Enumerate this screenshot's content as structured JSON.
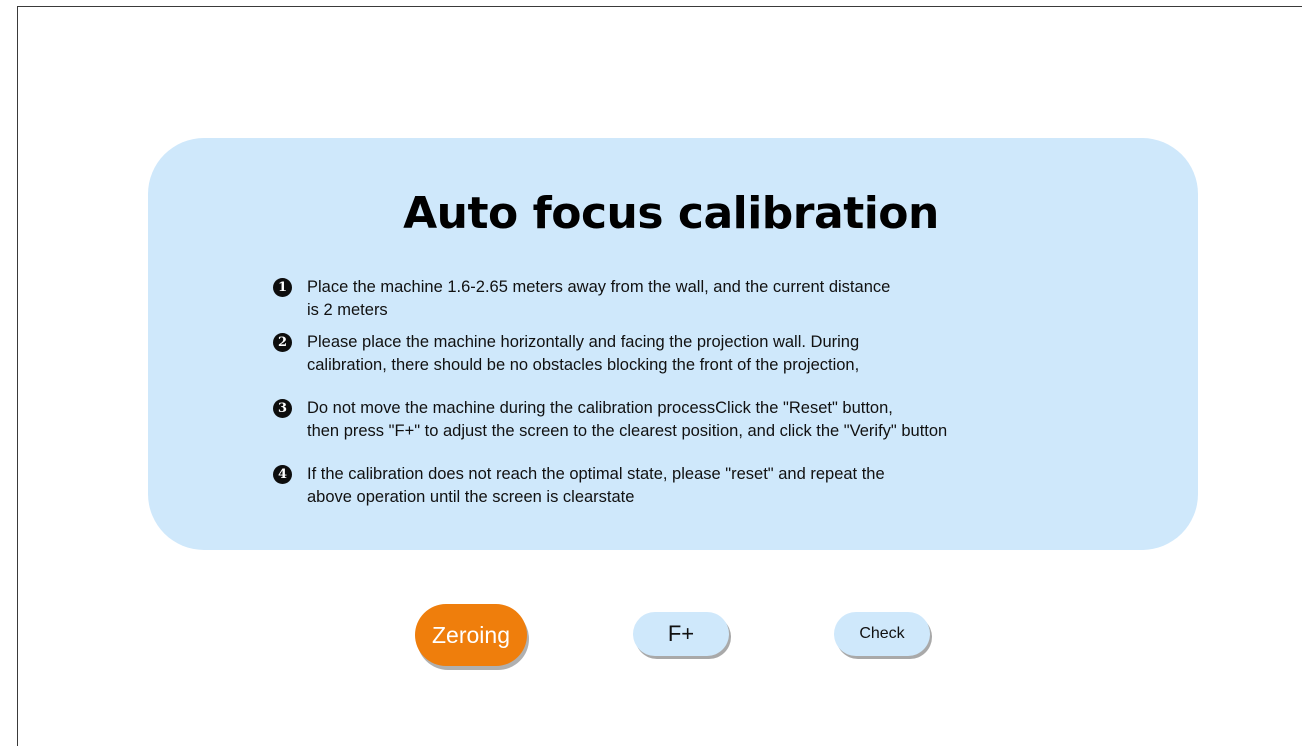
{
  "dialog": {
    "title": "Auto focus calibration",
    "steps": [
      {
        "number": "1",
        "lines": [
          "Place the machine 1.6-2.65 meters away from the wall, and the current distance",
          "is 2 meters"
        ]
      },
      {
        "number": "2",
        "lines": [
          "Please place the machine horizontally and facing the projection wall. During",
          "calibration, there should be no obstacles blocking the front of the projection,"
        ]
      },
      {
        "number": "3",
        "lines": [
          "Do not move the machine during the calibration processClick the \"Reset\" button,",
          "then press \"F+\" to adjust the screen to the clearest position, and click the \"Verify\" button"
        ]
      },
      {
        "number": "4",
        "lines": [
          "If the calibration does not reach the optimal state, please \"reset\" and repeat the",
          "above operation until the screen is clearstate"
        ]
      }
    ]
  },
  "buttons": {
    "zeroing": "Zeroing",
    "focus_plus": "F+",
    "check": "Check"
  },
  "colors": {
    "panel_background": "#cfe8fb",
    "primary_button": "#ef7e0c",
    "secondary_button": "#cfe8fb"
  }
}
